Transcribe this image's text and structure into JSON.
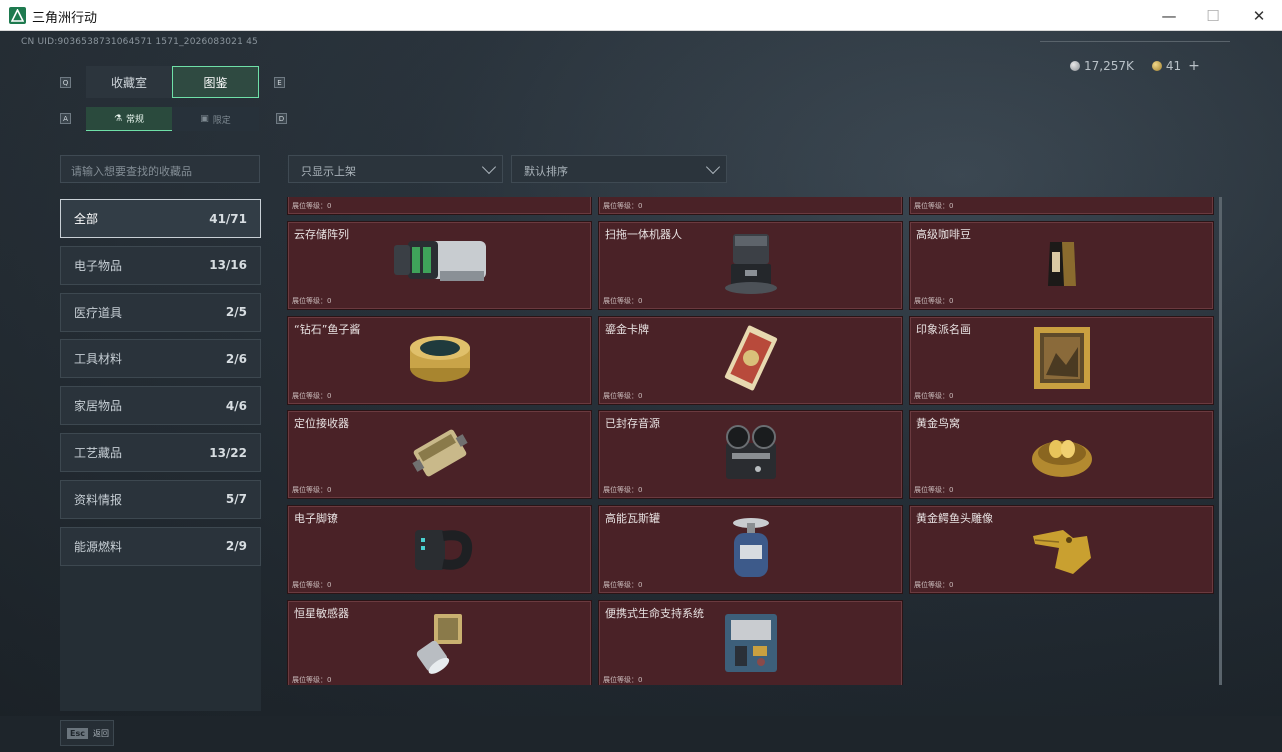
{
  "window": {
    "title": "三角洲行动",
    "minimize": "—",
    "maximize": "☐",
    "close": "✕"
  },
  "header": {
    "uid": "CN UID:9036538731064571 1571_2026083021 45",
    "currency1": "17,257K",
    "currency2": "41",
    "add": "+"
  },
  "tabs": {
    "key_left": "Q",
    "key_right": "E",
    "collection": "收藏室",
    "atlas": "图鉴"
  },
  "subtabs": {
    "key_left": "A",
    "key_right": "D",
    "normal": "常规",
    "limited": "限定"
  },
  "search": {
    "placeholder": "请输入想要查找的收藏品"
  },
  "filters": {
    "shelf": "只显示上架",
    "sort": "默认排序"
  },
  "categories": [
    {
      "label": "全部",
      "count": "41/71"
    },
    {
      "label": "电子物品",
      "count": "13/16"
    },
    {
      "label": "医疗道具",
      "count": "2/5"
    },
    {
      "label": "工具材料",
      "count": "2/6"
    },
    {
      "label": "家居物品",
      "count": "4/6"
    },
    {
      "label": "工艺藏品",
      "count": "13/22"
    },
    {
      "label": "资料情报",
      "count": "5/7"
    },
    {
      "label": "能源燃料",
      "count": "2/9"
    }
  ],
  "level_label": "展位等级：0",
  "items": [
    {
      "name": "",
      "icon": "partial-item-icon"
    },
    {
      "name": "",
      "icon": "partial-item-icon"
    },
    {
      "name": "",
      "icon": "partial-item-icon"
    },
    {
      "name": "云存储阵列",
      "icon": "cloud-storage-array-icon"
    },
    {
      "name": "扫拖一体机器人",
      "icon": "robot-vacuum-icon"
    },
    {
      "name": "高级咖啡豆",
      "icon": "coffee-bag-icon"
    },
    {
      "name": "“钻石”鱼子酱",
      "icon": "caviar-tin-icon"
    },
    {
      "name": "鎏金卡牌",
      "icon": "gold-card-icon"
    },
    {
      "name": "印象派名画",
      "icon": "framed-painting-icon"
    },
    {
      "name": "定位接收器",
      "icon": "gps-receiver-icon"
    },
    {
      "name": "已封存音源",
      "icon": "reel-recorder-icon"
    },
    {
      "name": "黄金鸟窝",
      "icon": "golden-nest-icon"
    },
    {
      "name": "电子脚镣",
      "icon": "ankle-monitor-icon"
    },
    {
      "name": "高能瓦斯罐",
      "icon": "gas-canister-icon"
    },
    {
      "name": "黄金鳄鱼头雕像",
      "icon": "golden-crocodile-icon"
    },
    {
      "name": "恒星敏感器",
      "icon": "star-sensor-icon"
    },
    {
      "name": "便携式生命支持系统",
      "icon": "life-support-icon"
    }
  ],
  "footer": {
    "esc_key": "Esc",
    "back": "返回"
  }
}
